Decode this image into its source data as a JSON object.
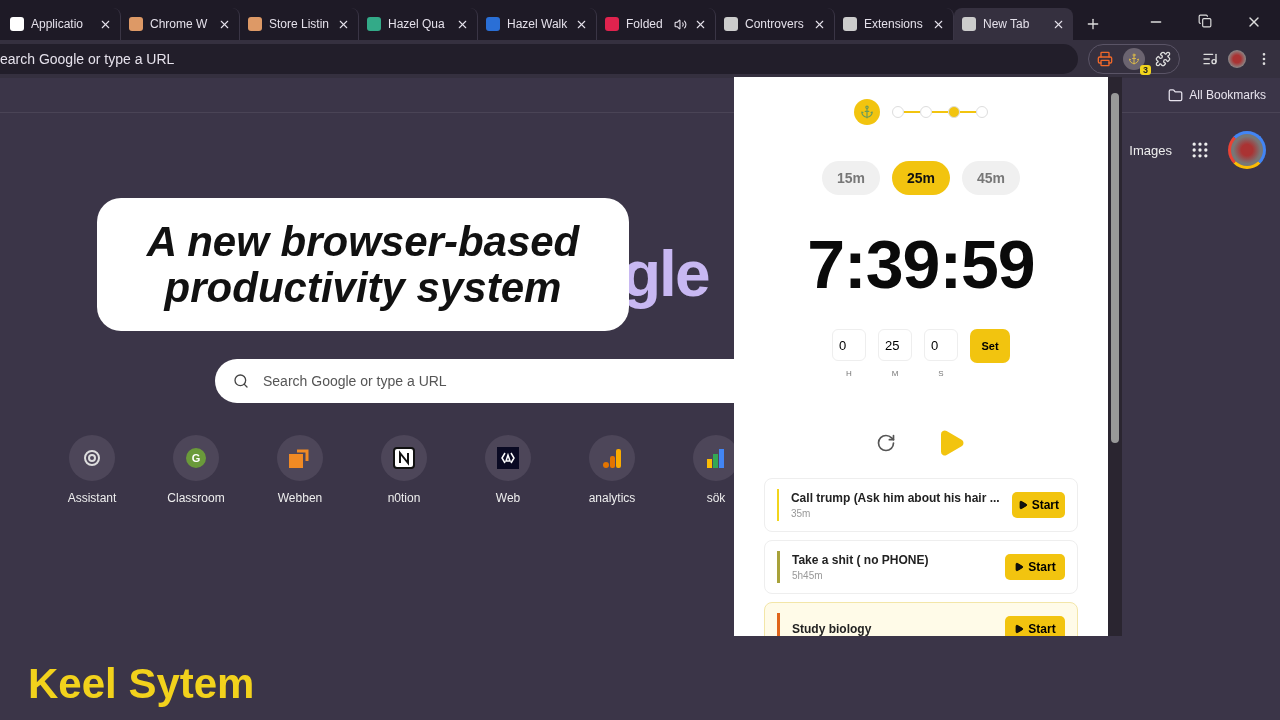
{
  "tabs": [
    {
      "title": "Applicatio",
      "selected": false,
      "audio": false
    },
    {
      "title": "Chrome W",
      "selected": false,
      "audio": false
    },
    {
      "title": "Store Listin",
      "selected": false,
      "audio": false
    },
    {
      "title": "Hazel Qua",
      "selected": false,
      "audio": false
    },
    {
      "title": "Hazel Walk",
      "selected": false,
      "audio": false
    },
    {
      "title": "Folded",
      "selected": false,
      "audio": true
    },
    {
      "title": "Controvers",
      "selected": false,
      "audio": false
    },
    {
      "title": "Extensions",
      "selected": false,
      "audio": false
    },
    {
      "title": "New Tab",
      "selected": true,
      "audio": false
    }
  ],
  "address_bar": {
    "text": "earch Google or type a URL"
  },
  "toolbar": {
    "extension_badge": "3"
  },
  "bookmarks_bar": {
    "folder": "All Bookmarks"
  },
  "new_tab": {
    "images_link": "Images",
    "logo": "gle",
    "search": {
      "placeholder": "Search Google or type a URL"
    },
    "shortcuts": [
      {
        "label": "Assistant"
      },
      {
        "label": "Classroom",
        "icon_letter": "G"
      },
      {
        "label": "Webben"
      },
      {
        "label": "n0tion"
      },
      {
        "label": "Web"
      },
      {
        "label": "analytics"
      },
      {
        "label": "sök"
      }
    ]
  },
  "caption": {
    "lines": [
      "A new browser-based",
      "productivity system"
    ]
  },
  "video_title": "Keel Sytem",
  "popup": {
    "steps": [
      {
        "selected": false
      },
      {
        "selected": false
      },
      {
        "selected": true
      },
      {
        "selected": false
      }
    ],
    "presets": [
      {
        "label": "15m",
        "selected": false
      },
      {
        "label": "25m",
        "selected": true
      },
      {
        "label": "45m",
        "selected": false
      }
    ],
    "timer": "7:39:59",
    "fields": [
      {
        "value": "0",
        "unit": "H"
      },
      {
        "value": "25",
        "unit": "M"
      },
      {
        "value": "0",
        "unit": "S"
      }
    ],
    "set_button": "Set",
    "tasks": [
      {
        "title": "Call trump (Ask him about his hair ...",
        "duration": "35m",
        "color": "#f2d51c",
        "highlighted": false,
        "button": "Start"
      },
      {
        "title": "Take a shit ( no PHONE)",
        "duration": "5h45m",
        "color": "#a8a23a",
        "highlighted": false,
        "button": "Start"
      },
      {
        "title": "Study biology",
        "color": "#e0651a",
        "highlighted": true,
        "button": "Start"
      }
    ]
  }
}
